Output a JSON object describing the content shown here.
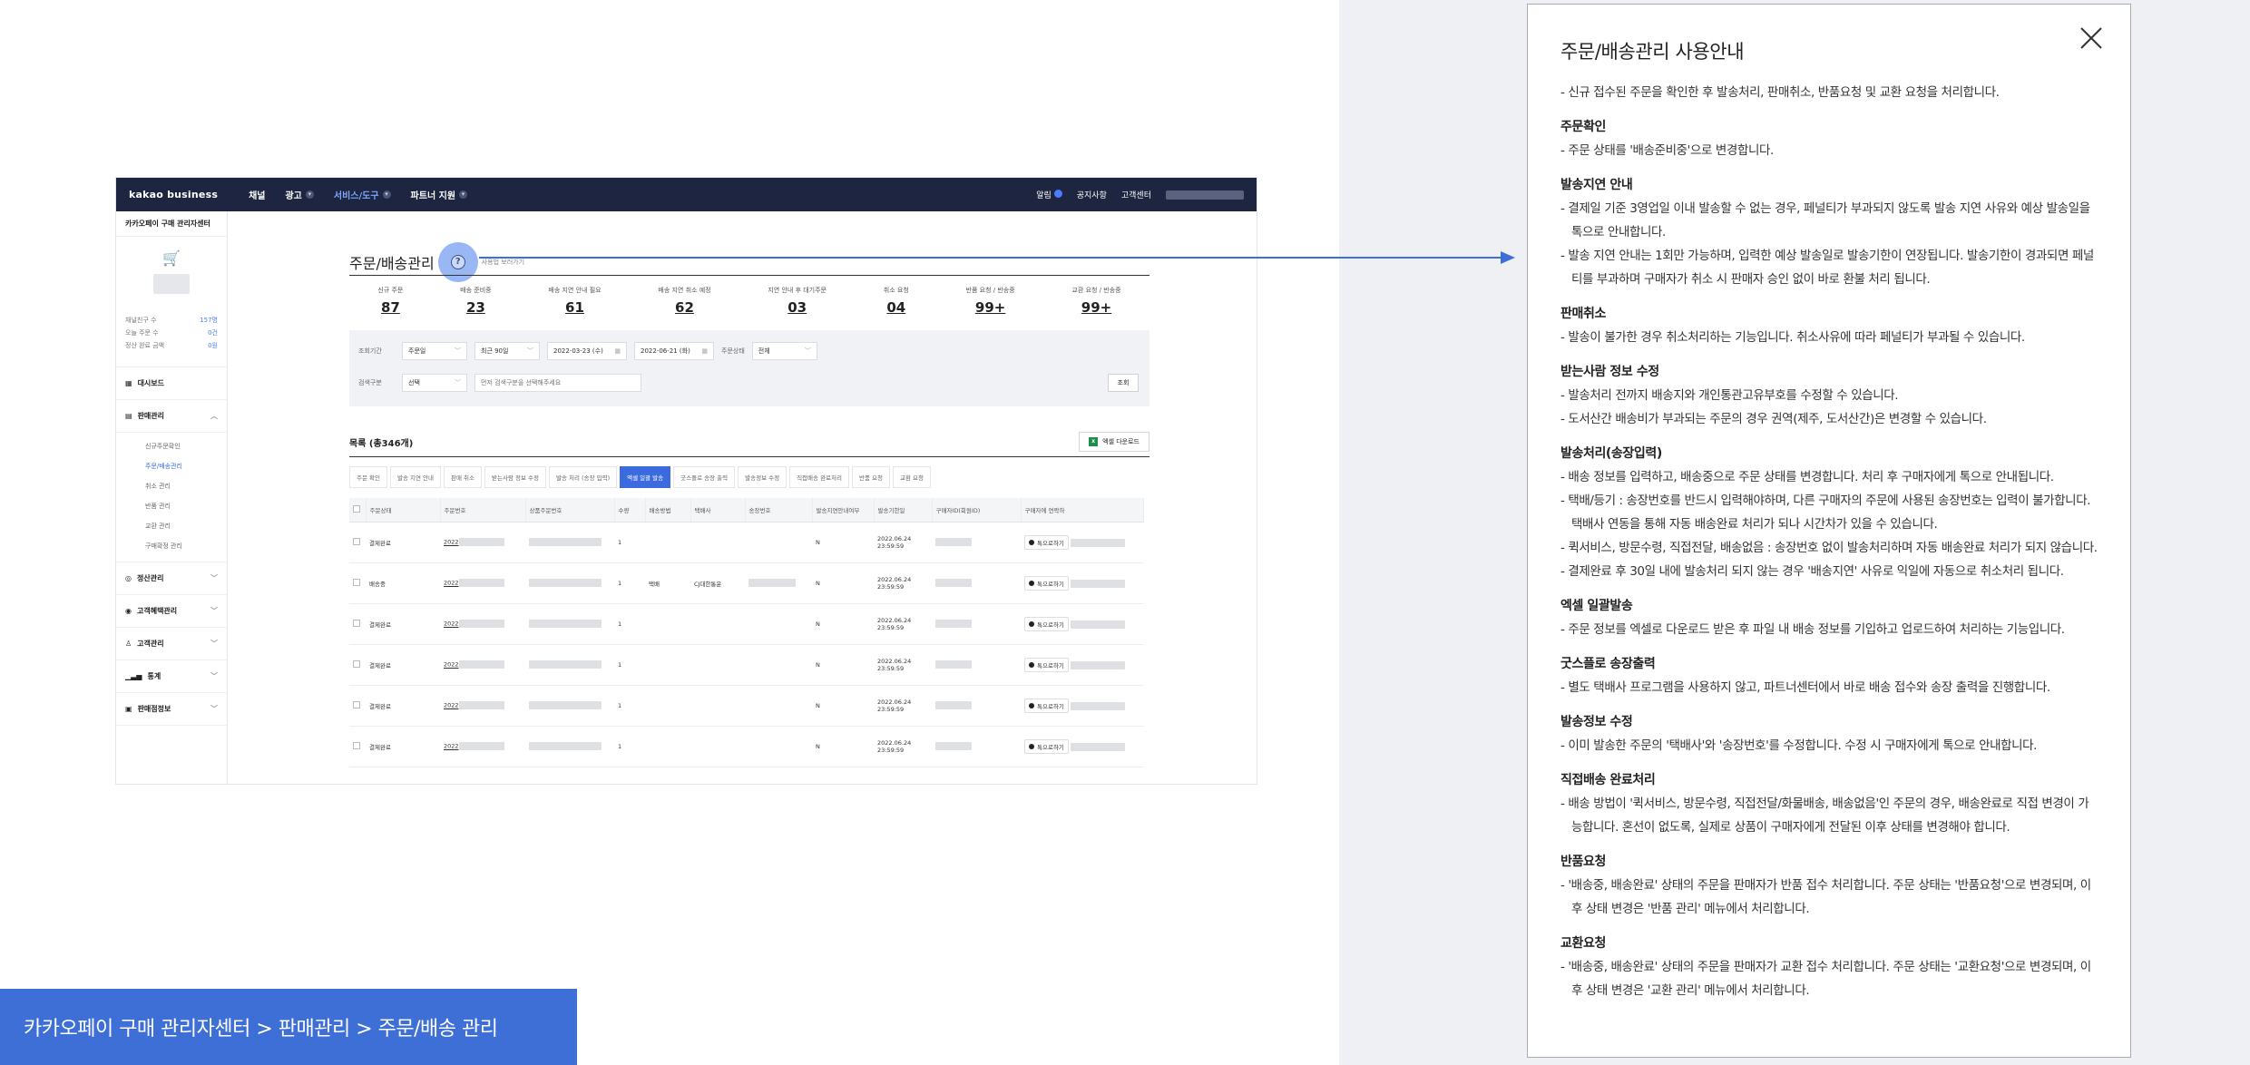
{
  "embedded": {
    "topnav": {
      "logo": "kakao business",
      "items": [
        "채널",
        "광고",
        "서비스/도구",
        "파트너 지원"
      ],
      "right": [
        "알림",
        "공지사항",
        "고객센터"
      ]
    },
    "sidebar": {
      "center_name": "카카오페이 구매 관리자센터",
      "stats": [
        {
          "label": "채널친구 수",
          "value": "157명"
        },
        {
          "label": "오늘 주문 수",
          "value": "0건"
        },
        {
          "label": "정산 완료 금액",
          "value": "0원"
        }
      ],
      "menu": [
        "대시보드",
        "판매관리",
        "정산관리",
        "고객혜택관리",
        "고객관리",
        "통계",
        "판매점정보"
      ],
      "submenu": [
        "신규주문확인",
        "주문/배송관리",
        "취소 관리",
        "반품 관리",
        "교환 관리",
        "구매확정 관리"
      ]
    },
    "page_title": "주문/배송관리",
    "help_caption": "사용법 보러가기",
    "status": [
      {
        "label": "신규 주문",
        "value": "87"
      },
      {
        "label": "배송 준비중",
        "value": "23"
      },
      {
        "label": "배송 지연 안내 필요",
        "value": "61"
      },
      {
        "label": "배송 지연 취소 예정",
        "value": "62"
      },
      {
        "label": "지연 안내 후 대기주문",
        "value": "03"
      },
      {
        "label": "취소 요청",
        "value": "04"
      },
      {
        "label": "반품 요청 / 반송중",
        "value": "99+"
      },
      {
        "label": "교환 요청 / 반송중",
        "value": "99+"
      }
    ],
    "filters": {
      "row1_label": "조회기간",
      "row1_type": "주문일",
      "row1_range": "최근 90일",
      "date_from": "2022-03-23 (수)",
      "date_to": "2022-06-21 (화)",
      "status_label": "주문상태",
      "status_value": "전체",
      "row2_label": "검색구분",
      "row2_select": "선택",
      "search_placeholder": "먼저 검색구분을 선택해주세요",
      "search_button": "조회"
    },
    "list_title": "목록 (총346개)",
    "excel_button": "엑셀 다운로드",
    "action_tabs": [
      "주문 확인",
      "발송 지연 안내",
      "판매 취소",
      "받는사람 정보 수정",
      "발송 처리 (송장 입력)",
      "엑셀 일괄 발송",
      "굿스플로 송장 출력",
      "발송정보 수정",
      "직접배송 완료처리",
      "반품 요청",
      "교환 요청"
    ],
    "table_headers": [
      "주문상태",
      "주문번호",
      "상품주문번호",
      "수량",
      "배송방법",
      "택배사",
      "송장번호",
      "발송지연안내여부",
      "발송기한일",
      "구매자ID(회원ID)",
      "구매자에 연락하"
    ],
    "rows": [
      {
        "status": "결제완료",
        "order_prefix": "2022",
        "qty": "1",
        "method": "",
        "courier": "",
        "delay": "N",
        "date": "2022.06.24",
        "time": "23:59:59",
        "contact": "톡으로하기"
      },
      {
        "status": "배송중",
        "order_prefix": "2022",
        "qty": "1",
        "method": "택배",
        "courier": "CJ대한통운",
        "delay": "N",
        "date": "2022.06.24",
        "time": "23:59:59",
        "contact": "톡으로하기"
      },
      {
        "status": "결제완료",
        "order_prefix": "2022",
        "qty": "1",
        "method": "",
        "courier": "",
        "delay": "N",
        "date": "2022.06.24",
        "time": "23:59:59",
        "contact": "톡으로하기"
      },
      {
        "status": "결제완료",
        "order_prefix": "2022",
        "qty": "1",
        "method": "",
        "courier": "",
        "delay": "N",
        "date": "2022.06.24",
        "time": "23:59:59",
        "contact": "톡으로하기"
      },
      {
        "status": "결제완료",
        "order_prefix": "2022",
        "qty": "1",
        "method": "",
        "courier": "",
        "delay": "N",
        "date": "2022.06.24",
        "time": "23:59:59",
        "contact": "톡으로하기"
      },
      {
        "status": "결제완료",
        "order_prefix": "2022",
        "qty": "1",
        "method": "",
        "courier": "",
        "delay": "N",
        "date": "2022.06.24",
        "time": "23:59:59",
        "contact": "톡으로하기"
      }
    ]
  },
  "breadcrumb": "카카오페이 구매 관리자센터 > 판매관리 > 주문/배송 관리",
  "help_panel": {
    "title": "주문/배송관리 사용안내",
    "intro": "- 신규 접수된 주문을 확인한 후 발송처리, 판매취소, 반품요청 및 교환 요청을 처리합니다.",
    "sections": [
      {
        "heading": "주문확인",
        "lines": [
          "- 주문 상태를 '배송준비중'으로 변경합니다."
        ]
      },
      {
        "heading": "발송지연 안내",
        "lines": [
          "- 결제일 기준 3영업일 이내 발송할 수 없는 경우, 페널티가 부과되지 않도록 발송 지연 사유와 예상 발송일을 톡으로 안내합니다.",
          "- 발송 지연 안내는 1회만 가능하며, 입력한 예상 발송일로 발송기한이 연장됩니다. 발송기한이 경과되면 페널티를 부과하며 구매자가 취소 시 판매자 승인 없이 바로 환불 처리 됩니다."
        ]
      },
      {
        "heading": "판매취소",
        "lines": [
          "- 발송이 불가한 경우 취소처리하는 기능입니다. 취소사유에 따라 페널티가 부과될 수 있습니다."
        ]
      },
      {
        "heading": "받는사람 정보 수정",
        "lines": [
          "- 발송처리 전까지 배송지와 개인통관고유부호를 수정할 수 있습니다.",
          "- 도서산간 배송비가 부과되는 주문의 경우 권역(제주, 도서산간)은 변경할 수 있습니다."
        ]
      },
      {
        "heading": "발송처리(송장입력)",
        "lines": [
          "- 배송 정보를 입력하고, 배송중으로 주문 상태를 변경합니다. 처리 후 구매자에게 톡으로 안내됩니다.",
          "- 택배/등기 : 송장번호를 반드시 입력해야하며, 다른 구매자의 주문에 사용된 송장번호는 입력이 불가합니다. 택배사 연동을 통해 자동 배송완료 처리가 되나 시간차가 있을 수 있습니다.",
          "- 퀵서비스, 방문수령, 직접전달, 배송없음 : 송장번호 없이 발송처리하며 자동 배송완료 처리가 되지 않습니다.",
          "- 결제완료 후 30일 내에 발송처리 되지 않는 경우 '배송지연' 사유로 익일에 자동으로 취소처리 됩니다."
        ]
      },
      {
        "heading": "엑셀 일괄발송",
        "lines": [
          "- 주문 정보를 엑셀로 다운로드 받은 후 파일 내 배송 정보를 기입하고 업로드하여 처리하는 기능입니다."
        ]
      },
      {
        "heading": "굿스플로 송장출력",
        "lines": [
          "- 별도 택배사 프로그램을 사용하지 않고, 파트너센터에서 바로 배송 접수와 송장 출력을 진행합니다."
        ]
      },
      {
        "heading": "발송정보 수정",
        "lines": [
          "- 이미 발송한 주문의 '택배사'와 '송장번호'를 수정합니다. 수정 시 구매자에게 톡으로 안내합니다."
        ]
      },
      {
        "heading": "직접배송 완료처리",
        "lines": [
          "- 배송 방법이 '퀵서비스, 방문수령, 직접전달/화물배송, 배송없음'인 주문의 경우, 배송완료로 직접 변경이 가능합니다. 혼선이 없도록, 실제로 상품이 구매자에게 전달된 이후 상태를 변경해야 합니다."
        ]
      },
      {
        "heading": "반품요청",
        "lines": [
          "- '배송중, 배송완료' 상태의 주문을 판매자가 반품 접수 처리합니다. 주문 상태는 '반품요청'으로 변경되며, 이후 상태 변경은 '반품 관리' 메뉴에서 처리합니다."
        ]
      },
      {
        "heading": "교환요청",
        "lines": [
          "- '배송중, 배송완료' 상태의 주문을 판매자가 교환 접수 처리합니다. 주문 상태는 '교환요청'으로 변경되며, 이후 상태 변경은 '교환 관리' 메뉴에서 처리합니다."
        ]
      }
    ]
  },
  "colors": {
    "accent": "#3d6fd6",
    "nav_bg": "#1d2540",
    "bubble": "#8fb0f4"
  }
}
